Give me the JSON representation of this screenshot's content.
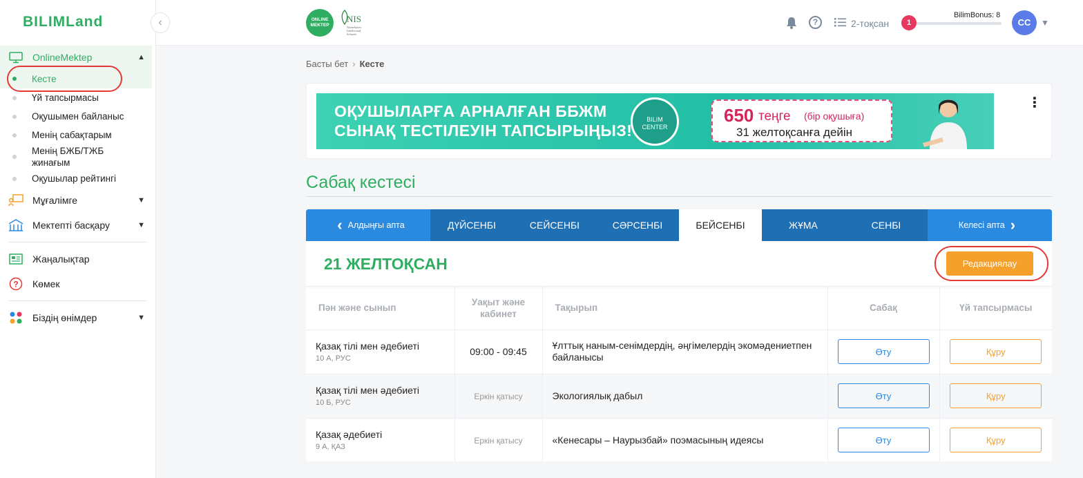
{
  "sidebar": {
    "logo": "BILIMLand",
    "collapse_glyph": "‹",
    "online_mektep": "OnlineMektep",
    "sub_items": [
      "Кесте",
      "Үй тапсырмасы",
      "Оқушымен байланыс",
      "Менің сабақтарым",
      "Менің БЖБ/ТЖБ жинағым",
      "Оқушылар рейтингі"
    ],
    "items": [
      "Мұғалімге",
      "Мектепті басқару",
      "Жаңалықтар",
      "Көмек",
      "Біздің өнімдер"
    ]
  },
  "header": {
    "om_logo": "ONLINE MEKTEP",
    "nis_big": "NIS",
    "nis_small": "Nazarbayev Intellectual Schools",
    "help_glyph": "?",
    "quarter": "2-тоқсан",
    "bonus_badge": "1",
    "bonus_label": "BilimBonus: 8",
    "avatar": "CC"
  },
  "breadcrumb": {
    "home": "Басты бет",
    "sep": "›",
    "current": "Кесте"
  },
  "banner": {
    "line1": "ОҚУШЫЛАРҒА АРНАЛҒАН ББЖМ",
    "line2": "СЫНАҚ ТЕСТІЛЕУІН ТАПСЫРЫҢЫЗ!",
    "circle_line1": "BILIM",
    "circle_line2": "CENTER",
    "price": "650",
    "price_unit": "теңге",
    "price_note": "(бір оқушыға)",
    "price_date": "31 желтоқсанға дейін",
    "menu_glyph": "⋮"
  },
  "page_title": "Сабақ кестесі",
  "schedule": {
    "prev_week": "Алдыңғы апта",
    "next_week": "Келесі апта",
    "days": [
      "ДҮЙСЕНБІ",
      "СЕЙСЕНБІ",
      "СӘРСЕНБІ",
      "БЕЙСЕНБІ",
      "ЖҰМА",
      "СЕНБІ"
    ],
    "active_day_index": 3,
    "date_title": "21 ЖЕЛТОҚСАН",
    "edit_button": "Редакциялау",
    "columns": {
      "subject": "Пән және сынып",
      "time": "Уақыт және кабинет",
      "topic": "Тақырып",
      "lesson": "Сабақ",
      "homework": "Үй тапсырмасы"
    },
    "rows": [
      {
        "subject": "Қазақ тілі мен әдебиеті",
        "class": "10 А, РУС",
        "time": "09:00 - 09:45",
        "topic": "Ұлттық наным-сенімдердің, әңгімелердің экомәдениетпен байланысы",
        "go": "Өту",
        "make": "Құру"
      },
      {
        "subject": "Қазақ тілі мен әдебиеті",
        "class": "10 Б, РУС",
        "time": "Еркін қатысу",
        "topic": "Экологиялық дабыл",
        "go": "Өту",
        "make": "Құру"
      },
      {
        "subject": "Қазақ әдебиеті",
        "class": "9 А, ҚАЗ",
        "time": "Еркін қатысу",
        "topic": "«Кенесары – Наурызбай» поэмасының идеясы",
        "go": "Өту",
        "make": "Құру"
      }
    ]
  },
  "colors": {
    "brand_green": "#2fae62",
    "tab_blue": "#1f6fb5",
    "accent_orange": "#f5a02b",
    "highlight_red": "#e53935"
  }
}
